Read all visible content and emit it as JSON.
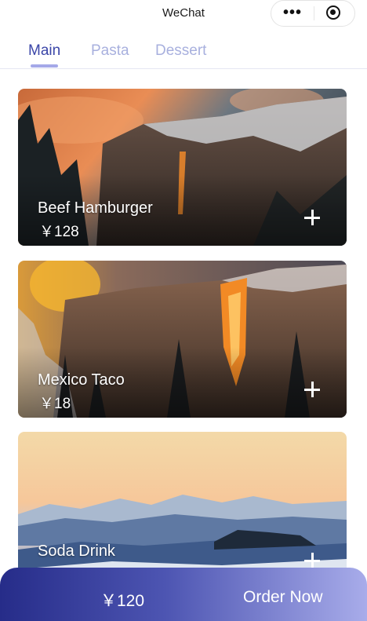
{
  "header": {
    "title": "WeChat",
    "menu_icon": "more-dots-icon",
    "close_icon": "target-circle-icon"
  },
  "tabs": [
    {
      "label": "Main",
      "active": true
    },
    {
      "label": "Pasta",
      "active": false
    },
    {
      "label": "Dessert",
      "active": false
    }
  ],
  "products": [
    {
      "name": "Beef Hamburger",
      "price": "￥128",
      "image": "sunset-cliff-waterfall"
    },
    {
      "name": "Mexico Taco",
      "price": "￥18",
      "image": "glowing-firefall-cliff"
    },
    {
      "name": "Soda Drink",
      "price": "",
      "image": "snowy-mountain-dawn"
    }
  ],
  "footer": {
    "total": "￥120",
    "order_label": "Order Now"
  },
  "colors": {
    "tab_active": "#3b46a8",
    "tab_inactive": "#a8b0de",
    "footer_gradient_start": "#262c89",
    "footer_gradient_end": "#a8acea"
  }
}
